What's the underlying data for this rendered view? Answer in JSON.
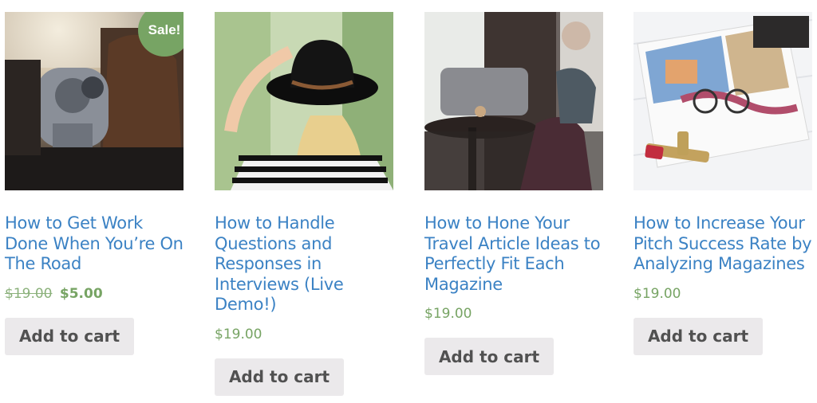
{
  "products": [
    {
      "title": "How to Get Work Done When You’re On The Road",
      "sale_badge": "Sale!",
      "price_regular": "$19.00",
      "price_sale": "$5.00",
      "button_label": "Add to cart",
      "image_desc_icon": "binoculars-viewer-photo"
    },
    {
      "title": "How to Handle Questions and Responses in Interviews (Live Demo!)",
      "price": "$19.00",
      "button_label": "Add to cart",
      "image_desc_icon": "hat-woman-photo"
    },
    {
      "title": "How to Hone Your Travel Article Ideas to Perfectly Fit Each Magazine",
      "price": "$19.00",
      "button_label": "Add to cart",
      "image_desc_icon": "cafe-table-photo"
    },
    {
      "title": "How to Increase Your Pitch Success Rate by Analyzing Magazines",
      "price": "$19.00",
      "button_label": "Add to cart",
      "image_desc_icon": "magazine-lipstick-photo"
    }
  ],
  "colors": {
    "link": "#3b82c4",
    "price": "#77a464",
    "sale_badge": "#77a464",
    "button_bg": "#ebe9eb",
    "button_text": "#515151"
  }
}
